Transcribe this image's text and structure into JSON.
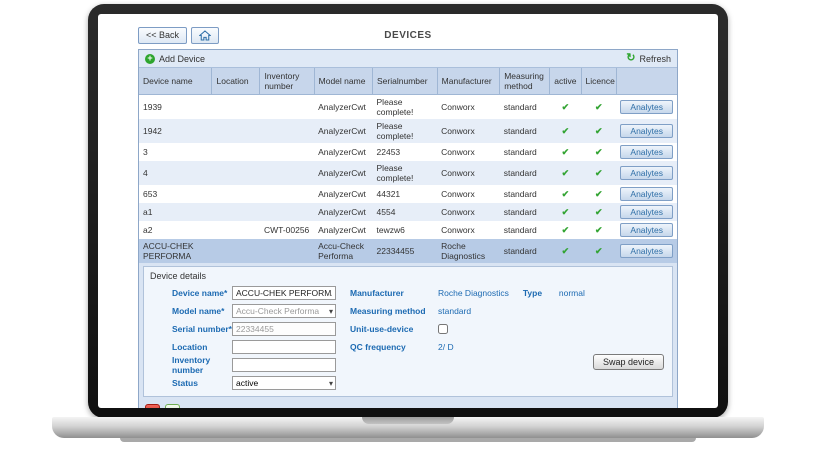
{
  "topbar": {
    "back_label": "<< Back",
    "title": "DEVICES"
  },
  "toolbar": {
    "add_device_label": "Add Device",
    "refresh_label": "Refresh"
  },
  "table": {
    "columns": [
      "Device name",
      "Location",
      "Inventory number",
      "Model name",
      "Serialnumber",
      "Manufacturer",
      "Measuring method",
      "active",
      "Licence",
      ""
    ],
    "rows": [
      {
        "device_name": "1939",
        "location": "",
        "inventory_number": "",
        "model_name": "AnalyzerCwt",
        "serial_number": "Please complete!",
        "manufacturer": "Conworx",
        "measuring_method": "standard",
        "active": "✔",
        "licence": "✔",
        "action": "Analytes"
      },
      {
        "device_name": "1942",
        "location": "",
        "inventory_number": "",
        "model_name": "AnalyzerCwt",
        "serial_number": "Please complete!",
        "manufacturer": "Conworx",
        "measuring_method": "standard",
        "active": "✔",
        "licence": "✔",
        "action": "Analytes"
      },
      {
        "device_name": "3",
        "location": "",
        "inventory_number": "",
        "model_name": "AnalyzerCwt",
        "serial_number": "22453",
        "manufacturer": "Conworx",
        "measuring_method": "standard",
        "active": "✔",
        "licence": "✔",
        "action": "Analytes"
      },
      {
        "device_name": "4",
        "location": "",
        "inventory_number": "",
        "model_name": "AnalyzerCwt",
        "serial_number": "Please complete!",
        "manufacturer": "Conworx",
        "measuring_method": "standard",
        "active": "✔",
        "licence": "✔",
        "action": "Analytes"
      },
      {
        "device_name": "653",
        "location": "",
        "inventory_number": "",
        "model_name": "AnalyzerCwt",
        "serial_number": "44321",
        "manufacturer": "Conworx",
        "measuring_method": "standard",
        "active": "✔",
        "licence": "✔",
        "action": "Analytes"
      },
      {
        "device_name": "a1",
        "location": "",
        "inventory_number": "",
        "model_name": "AnalyzerCwt",
        "serial_number": "4554",
        "manufacturer": "Conworx",
        "measuring_method": "standard",
        "active": "✔",
        "licence": "✔",
        "action": "Analytes"
      },
      {
        "device_name": "a2",
        "location": "",
        "inventory_number": "CWT-00256",
        "model_name": "AnalyzerCwt",
        "serial_number": "tewzw6",
        "manufacturer": "Conworx",
        "measuring_method": "standard",
        "active": "✔",
        "licence": "✔",
        "action": "Analytes"
      },
      {
        "device_name": "ACCU-CHEK PERFORMA",
        "location": "",
        "inventory_number": "",
        "model_name": "Accu-Check Performa",
        "serial_number": "22334455",
        "manufacturer": "Roche Diagnostics",
        "measuring_method": "standard",
        "active": "✔",
        "licence": "✔",
        "action": "Analytes"
      }
    ]
  },
  "details": {
    "title": "Device details",
    "device_name_label": "Device name*",
    "device_name_value": "ACCU-CHEK PERFORMA",
    "model_name_label": "Model name*",
    "model_name_value": "Accu-Check Performa",
    "serial_number_label": "Serial number*",
    "serial_number_value": "22334455",
    "location_label": "Location",
    "location_value": "",
    "inventory_number_label": "Inventory number",
    "inventory_number_value": "",
    "status_label": "Status",
    "status_value": "active",
    "manufacturer_label": "Manufacturer",
    "manufacturer_value": "Roche Diagnostics",
    "measuring_method_label": "Measuring method",
    "measuring_method_value": "standard",
    "unit_use_label": "Unit-use-device",
    "qc_frequency_label": "QC frequency",
    "qc_frequency_value": "2/ D",
    "type_label": "Type",
    "type_value": "normal",
    "swap_button_label": "Swap device"
  },
  "colors": {
    "accent_blue": "#1c6ab2",
    "check_green": "#33a433",
    "selected_row": "#b7cbe6"
  }
}
